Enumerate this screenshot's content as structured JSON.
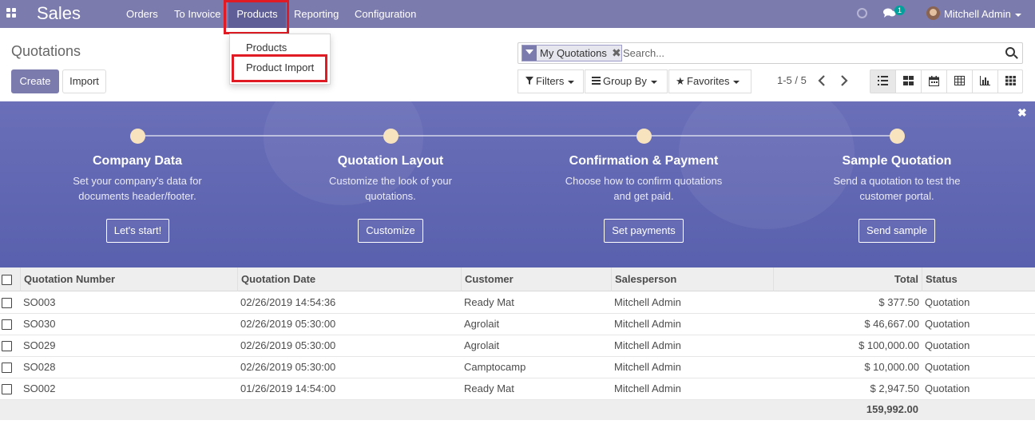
{
  "app": {
    "name": "Sales"
  },
  "nav": {
    "menu": [
      {
        "label": "Orders"
      },
      {
        "label": "To Invoice"
      },
      {
        "label": "Products"
      },
      {
        "label": "Reporting"
      },
      {
        "label": "Configuration"
      }
    ],
    "notification_count": "1",
    "user_name": "Mitchell Admin"
  },
  "products_dropdown": {
    "items": [
      {
        "label": "Products"
      },
      {
        "label": "Product Import"
      }
    ]
  },
  "control_panel": {
    "title": "Quotations",
    "create_label": "Create",
    "import_label": "Import",
    "search": {
      "facet": "My Quotations",
      "placeholder": "Search..."
    },
    "filters_label": "Filters",
    "group_by_label": "Group By",
    "favorites_label": "Favorites",
    "pager": "1-5 / 5"
  },
  "onboarding": {
    "steps": [
      {
        "title": "Company Data",
        "description_lines": [
          "Set your company's data for",
          "documents header/footer."
        ],
        "button": "Let's start!"
      },
      {
        "title": "Quotation Layout",
        "description_lines": [
          "Customize the look of your",
          "quotations."
        ],
        "button": "Customize"
      },
      {
        "title": "Confirmation & Payment",
        "description_lines": [
          "Choose how to confirm quotations",
          "and get paid."
        ],
        "button": "Set payments"
      },
      {
        "title": "Sample Quotation",
        "description_lines": [
          "Send a quotation to test the",
          "customer portal."
        ],
        "button": "Send sample"
      }
    ]
  },
  "table": {
    "columns": [
      "Quotation Number",
      "Quotation Date",
      "Customer",
      "Salesperson",
      "Total",
      "Status"
    ],
    "rows": [
      {
        "number": "SO003",
        "date": "02/26/2019 14:54:36",
        "customer": "Ready Mat",
        "salesperson": "Mitchell Admin",
        "total": "$ 377.50",
        "status": "Quotation"
      },
      {
        "number": "SO030",
        "date": "02/26/2019 05:30:00",
        "customer": "Agrolait",
        "salesperson": "Mitchell Admin",
        "total": "$ 46,667.00",
        "status": "Quotation"
      },
      {
        "number": "SO029",
        "date": "02/26/2019 05:30:00",
        "customer": "Agrolait",
        "salesperson": "Mitchell Admin",
        "total": "$ 100,000.00",
        "status": "Quotation"
      },
      {
        "number": "SO028",
        "date": "02/26/2019 05:30:00",
        "customer": "Camptocamp",
        "salesperson": "Mitchell Admin",
        "total": "$ 10,000.00",
        "status": "Quotation"
      },
      {
        "number": "SO002",
        "date": "01/26/2019 14:54:00",
        "customer": "Ready Mat",
        "salesperson": "Mitchell Admin",
        "total": "$ 2,947.50",
        "status": "Quotation"
      }
    ],
    "sum_total": "159,992.00"
  },
  "colors": {
    "brand": "#7c7bad",
    "highlight": "#e01b24",
    "banner": "#5e64b0",
    "step_dot": "#f8e3bf"
  }
}
